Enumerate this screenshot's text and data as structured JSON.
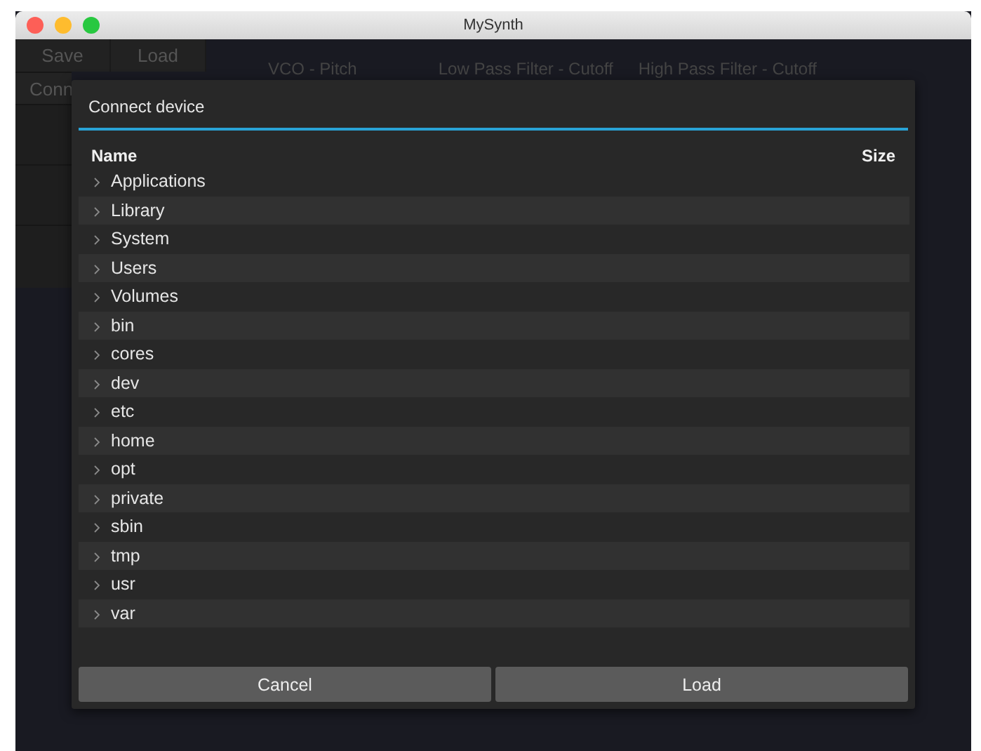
{
  "window": {
    "title": "MySynth"
  },
  "toolbar": {
    "buttons": [
      "Save",
      "Load"
    ],
    "connect_button": "Conn"
  },
  "parameter_labels": [
    "VCO - Pitch",
    "Low Pass Filter - Cutoff",
    "High Pass Filter - Cutoff"
  ],
  "dialog": {
    "title": "Connect device",
    "columns": [
      "Name",
      "Size"
    ],
    "rows": [
      {
        "name": "Applications",
        "expanded": false
      },
      {
        "name": "Library",
        "expanded": false
      },
      {
        "name": "System",
        "expanded": false
      },
      {
        "name": "Users",
        "expanded": false
      },
      {
        "name": "Volumes",
        "expanded": false
      },
      {
        "name": "bin",
        "expanded": false
      },
      {
        "name": "cores",
        "expanded": false
      },
      {
        "name": "dev",
        "expanded": false
      },
      {
        "name": "etc",
        "expanded": false
      },
      {
        "name": "home",
        "expanded": false
      },
      {
        "name": "opt",
        "expanded": false
      },
      {
        "name": "private",
        "expanded": false
      },
      {
        "name": "sbin",
        "expanded": false
      },
      {
        "name": "tmp",
        "expanded": false
      },
      {
        "name": "usr",
        "expanded": false
      },
      {
        "name": "var",
        "expanded": false
      }
    ],
    "buttons": [
      "Cancel",
      "Load"
    ]
  }
}
